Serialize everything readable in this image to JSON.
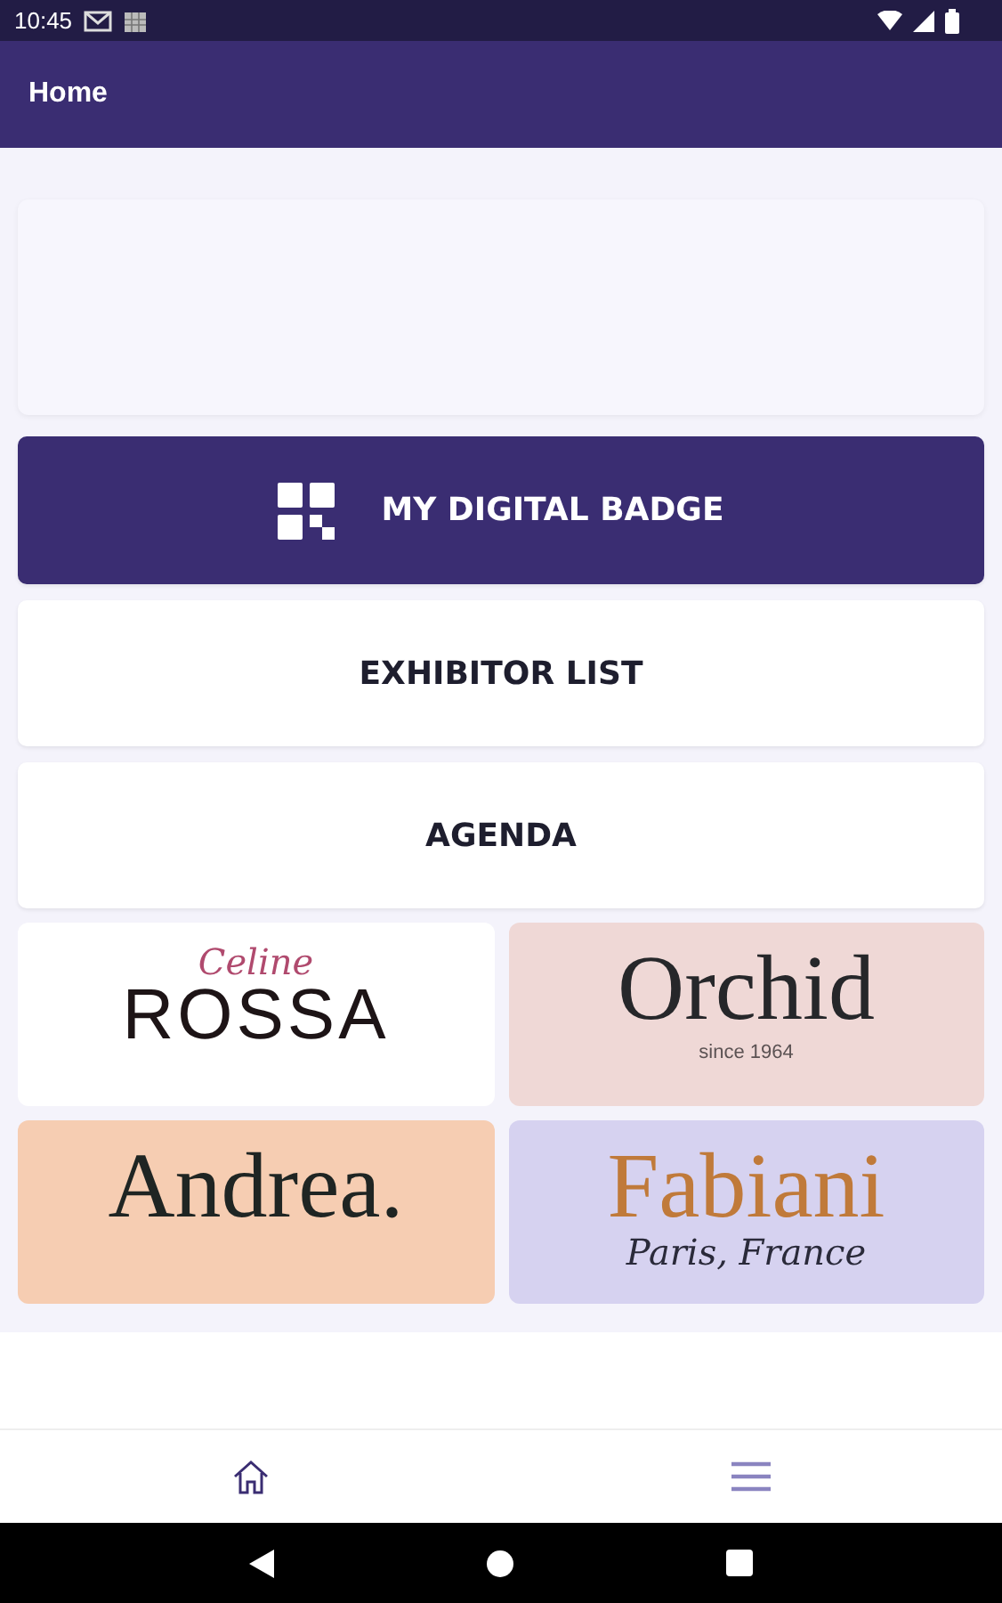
{
  "status_bar": {
    "time": "10:45"
  },
  "app_bar": {
    "title": "Home"
  },
  "menu": [
    {
      "label": "MY DIGITAL BADGE",
      "kind": "primary"
    },
    {
      "label": "EXHIBITOR LIST",
      "kind": "plain"
    },
    {
      "label": "AGENDA",
      "kind": "plain"
    }
  ],
  "sponsors": [
    {
      "color": "#ffffff",
      "lines": [
        {
          "text": "Celine",
          "kind": "script",
          "color": "#b04a6e"
        },
        {
          "text": "ROSSA",
          "kind": "caps",
          "color": "#1d1416"
        }
      ]
    },
    {
      "color": "#efd8d6",
      "lines": [
        {
          "text": "Orchid",
          "kind": "serif",
          "color": "#26272a"
        },
        {
          "text": "since 1964",
          "kind": "small",
          "color": "#5b5253"
        }
      ]
    },
    {
      "color": "#f6cdb2",
      "lines": [
        {
          "text": "Andrea.",
          "kind": "serif",
          "color": "#1f2523"
        }
      ]
    },
    {
      "color": "#d6d2f0",
      "lines": [
        {
          "text": "Fabiani",
          "kind": "serif",
          "color": "#c07a3a"
        },
        {
          "text": "Paris, France",
          "kind": "script",
          "color": "#2a2a3a"
        }
      ]
    }
  ],
  "bottom_nav": [
    {
      "kind": "home",
      "selected": true
    },
    {
      "kind": "menu",
      "selected": false
    }
  ]
}
